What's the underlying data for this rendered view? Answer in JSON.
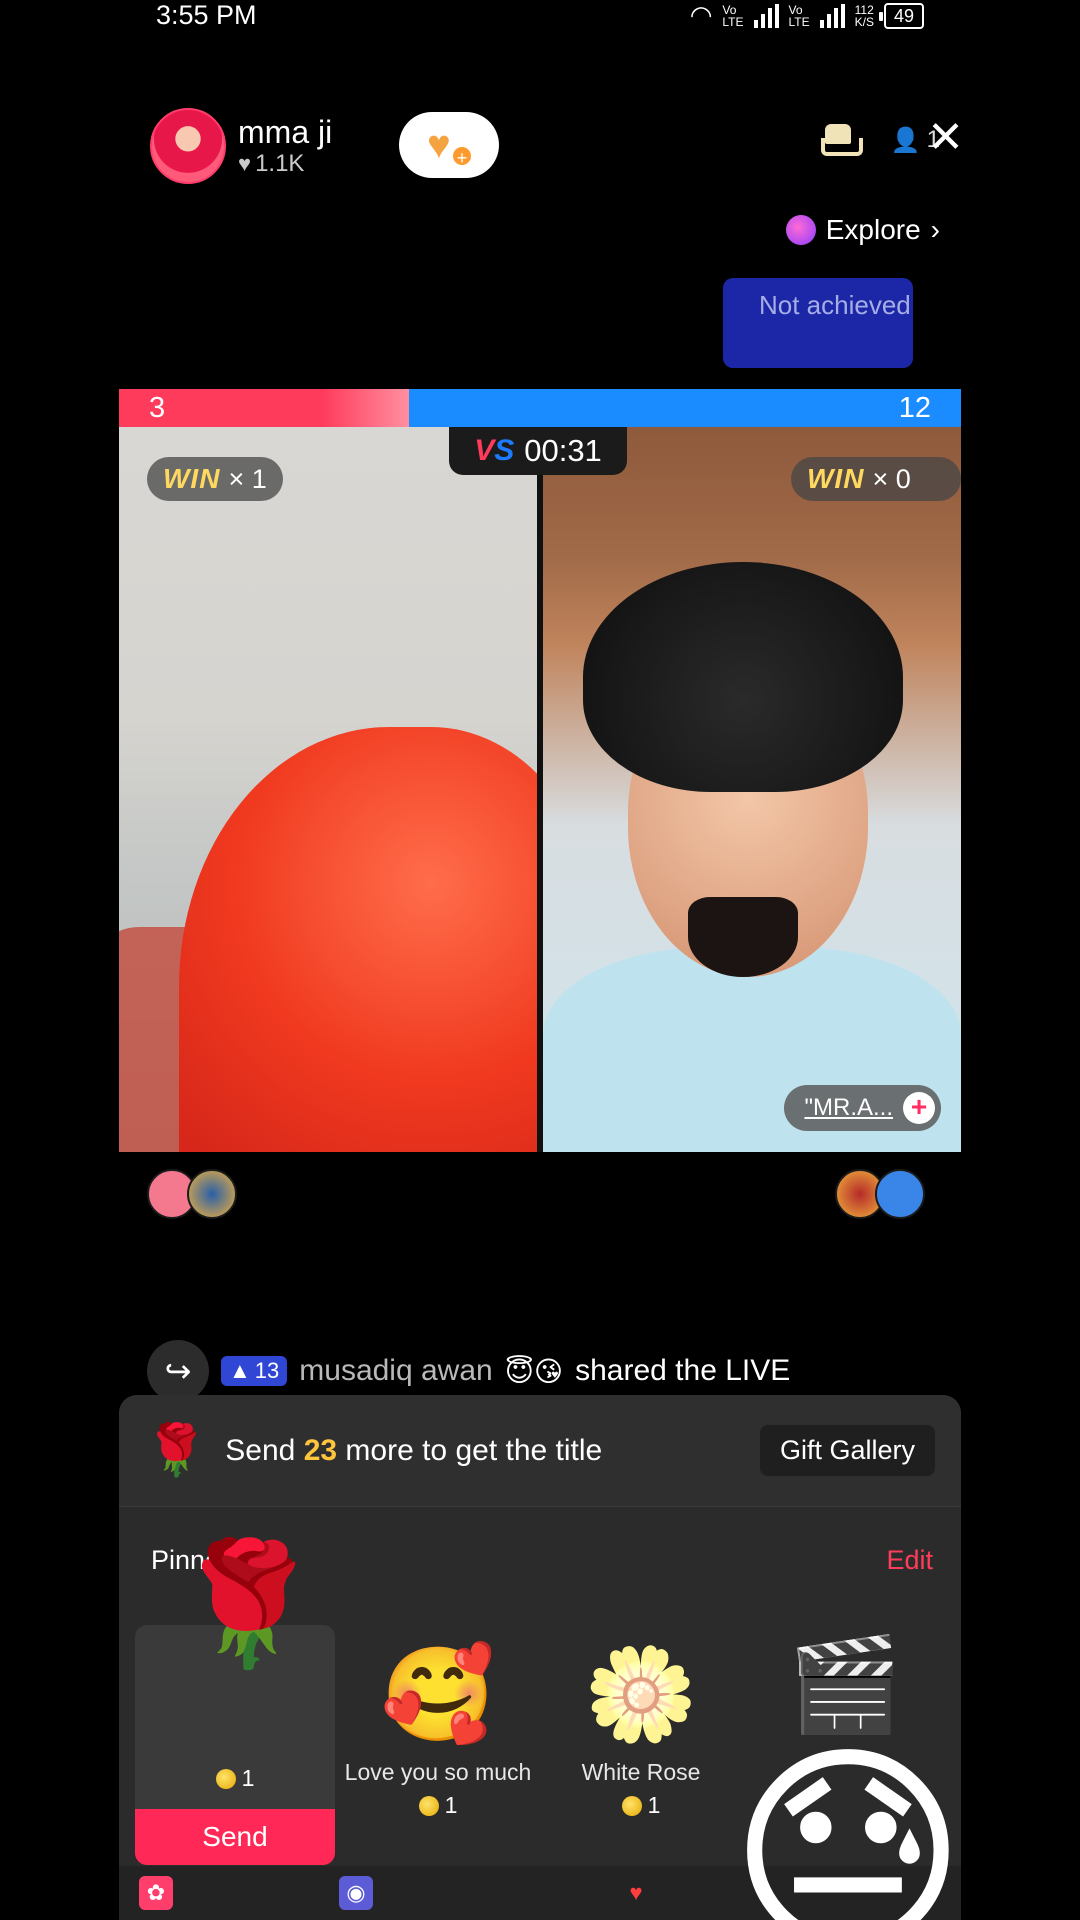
{
  "status_bar": {
    "time": "3:55 PM",
    "net_speed": "112\nK/S",
    "lte1": "Vo\nLTE",
    "lte2": "Vo\nLTE",
    "battery": "49"
  },
  "host": {
    "name": "mma ji",
    "likes": "1.1K"
  },
  "viewers_count": "1",
  "explore_label": "Explore",
  "goal_badge": "Not achieved",
  "battle": {
    "score_left": "3",
    "score_right": "12",
    "vs_label": "VS",
    "timer": "00:31",
    "win_word": "WIN",
    "left_wins": "× 1",
    "right_wins": "× 0",
    "opponent_name": "\"MR.A..."
  },
  "share_line": {
    "level": "13",
    "user": "musadiq awan",
    "emojis": "😇😘",
    "action": "shared the LIVE"
  },
  "gift_panel": {
    "goal_prefix": "Send",
    "goal_count": "23",
    "goal_suffix": "more to get the title",
    "gallery_label": "Gift Gallery",
    "pinned_label": "Pinned",
    "edit_label": "Edit",
    "send_label": "Send",
    "gifts": [
      {
        "name": "",
        "cost": "1",
        "icon": "🌹"
      },
      {
        "name": "Love you so much",
        "cost": "1",
        "icon": "🥰"
      },
      {
        "name": "White Rose",
        "cost": "1",
        "icon": "🌼"
      },
      {
        "name": "",
        "cost": "",
        "icon": "🎬"
      }
    ]
  },
  "overlay_emoji": "😓",
  "colors": {
    "red_team": "#ff3b5c",
    "blue_team": "#1a8cff",
    "accent": "#ff2856",
    "gold": "#ffc53d"
  }
}
